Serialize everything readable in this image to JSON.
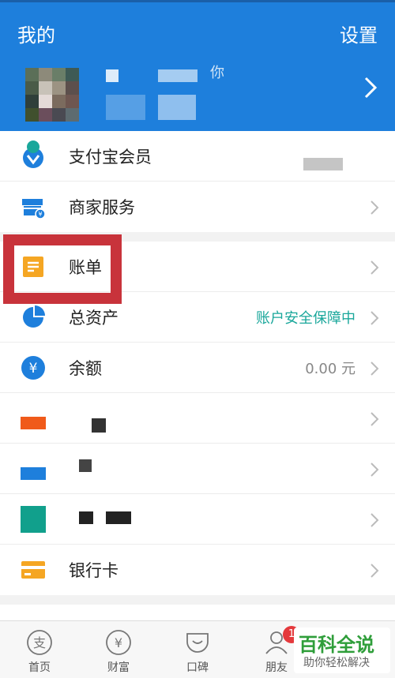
{
  "header": {
    "title": "我的",
    "settings_label": "设置",
    "profile_name_fragment": "你"
  },
  "colors": {
    "header_bg": "#1e7fdc",
    "teal_text": "#1aa79b",
    "highlight_red": "#c8333b",
    "badge_red": "#e4393c"
  },
  "menu": {
    "member": {
      "label": "支付宝会员"
    },
    "merchant": {
      "label": "商家服务"
    },
    "bill": {
      "label": "账单"
    },
    "assets": {
      "label": "总资产",
      "value": "账户安全保障中"
    },
    "balance": {
      "label": "余额",
      "value": "0.00 元"
    },
    "bank_card": {
      "label": "银行卡"
    }
  },
  "tabs": [
    {
      "label": "首页",
      "icon": "home-icon"
    },
    {
      "label": "财富",
      "icon": "wealth-icon"
    },
    {
      "label": "口碑",
      "icon": "koubei-icon"
    },
    {
      "label": "朋友",
      "icon": "friends-icon",
      "badge": "1"
    }
  ],
  "watermark": {
    "main": "百科全说",
    "sub": "助你轻松解决"
  }
}
